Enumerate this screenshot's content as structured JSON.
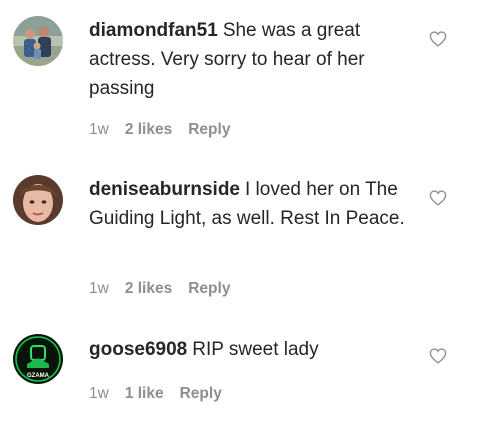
{
  "comments": [
    {
      "username": "diamondfan51",
      "text": "She was a great actress. Very sorry to hear of her passing",
      "time": "1w",
      "likes": "2 likes",
      "reply": "Reply",
      "avatar_icon": "family-photo-avatar",
      "heart_icon": "heart-outline-icon"
    },
    {
      "username": "deniseaburnside",
      "text": "I loved her on The Guiding Light, as well. Rest In Peace.",
      "time": "1w",
      "likes": "2 likes",
      "reply": "Reply",
      "avatar_icon": "portrait-avatar",
      "heart_icon": "heart-outline-icon"
    },
    {
      "username": "goose6908",
      "text": "RIP sweet lady",
      "time": "1w",
      "likes": "1 like",
      "reply": "Reply",
      "avatar_icon": "green-logo-avatar",
      "avatar_logo_text": "GZAMA",
      "heart_icon": "heart-outline-icon"
    }
  ],
  "colors": {
    "text": "#262626",
    "meta": "#8e8e8e",
    "heart_outline": "#8e8e8e",
    "background": "#ffffff"
  }
}
